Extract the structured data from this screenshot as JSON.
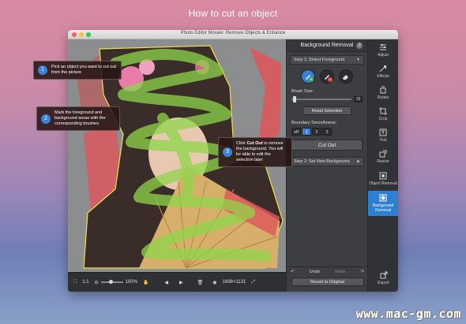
{
  "headline": "How to cut an object",
  "window": {
    "title": "Photo Editor Movavi: Remove Objects & Enhance"
  },
  "panel": {
    "title": "Background Removal",
    "step1": "Step 1: Select Foreground",
    "brush_size_label": "Brush Size:",
    "brush_size_value": "15",
    "reset_selection": "Reset Selection",
    "boundary_label": "Boundary Smoothness:",
    "smoothness_options": [
      "off",
      "1",
      "2",
      "3"
    ],
    "smoothness_selected": "1",
    "cut_out": "Cut Out",
    "step2": "Step 2: Set New Background",
    "undo": "Undo",
    "redo": "Redo",
    "revert": "Revert to Original"
  },
  "tools": [
    {
      "label": "Adjust",
      "icon": "sliders-icon"
    },
    {
      "label": "Effects",
      "icon": "effects-icon"
    },
    {
      "label": "Rotate",
      "icon": "rotate-icon"
    },
    {
      "label": "Crop",
      "icon": "crop-icon"
    },
    {
      "label": "Text",
      "icon": "text-icon"
    },
    {
      "label": "Resize",
      "icon": "resize-icon"
    },
    {
      "label": "Object Removal",
      "icon": "object-removal-icon"
    },
    {
      "label": "Background Removal",
      "icon": "background-removal-icon"
    },
    {
      "label": "Export",
      "icon": "export-icon"
    }
  ],
  "bottombar": {
    "ratio": "1:1",
    "zoom": "100%",
    "dimensions": "1698×1131"
  },
  "callouts": [
    {
      "num": "1",
      "text": "Pick an object you want to cut out from the picture"
    },
    {
      "num": "2",
      "text": "Mark the foreground and background areas with the corresponding brushes"
    },
    {
      "num": "3",
      "bold": "Cut Out",
      "pre": "Click ",
      "text": "to remove the background. You will be able to edit the selection later"
    }
  ],
  "watermark": "www.mac-gm.com",
  "colors": {
    "accent": "#3b7fd0",
    "foreground_mark": "#8ed64a",
    "background_mark": "#e0555a"
  }
}
